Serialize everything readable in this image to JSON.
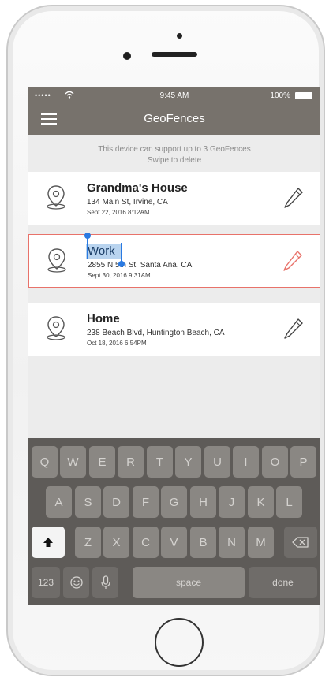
{
  "status_bar": {
    "signal": "•••••",
    "time": "9:45 AM",
    "battery": "100%"
  },
  "navbar": {
    "title": "GeoFences"
  },
  "info": {
    "line1": "This device can support up to 3 GeoFences",
    "line2": "Swipe to delete"
  },
  "geofences": [
    {
      "name": "Grandma's House",
      "address": "134 Main St, Irvine, CA",
      "date": "Sept 22, 2016 8:12AM"
    },
    {
      "name": "Work",
      "address": "2855 N 5th St, Santa Ana, CA",
      "date": "Sept 30, 2016 9:31AM"
    },
    {
      "name": "Home",
      "address": "238 Beach Blvd, Huntington Beach, CA",
      "date": "Oct 18, 2016 6:54PM"
    }
  ],
  "keyboard": {
    "row1": [
      "Q",
      "W",
      "E",
      "R",
      "T",
      "Y",
      "U",
      "I",
      "O",
      "P"
    ],
    "row2": [
      "A",
      "S",
      "D",
      "F",
      "G",
      "H",
      "J",
      "K",
      "L"
    ],
    "row3": [
      "Z",
      "X",
      "C",
      "V",
      "B",
      "N",
      "M"
    ],
    "numbers": "123",
    "space": "space",
    "done": "done"
  },
  "colors": {
    "bar": "#77726c",
    "selected_border": "#e8726a",
    "selection": "#b9d4ef",
    "handle": "#2a7ae2"
  },
  "icons": [
    "menu-icon",
    "map-pin-icon",
    "pencil-icon",
    "wifi-icon",
    "battery-icon",
    "shift-icon",
    "backspace-icon",
    "emoji-icon",
    "microphone-icon"
  ]
}
